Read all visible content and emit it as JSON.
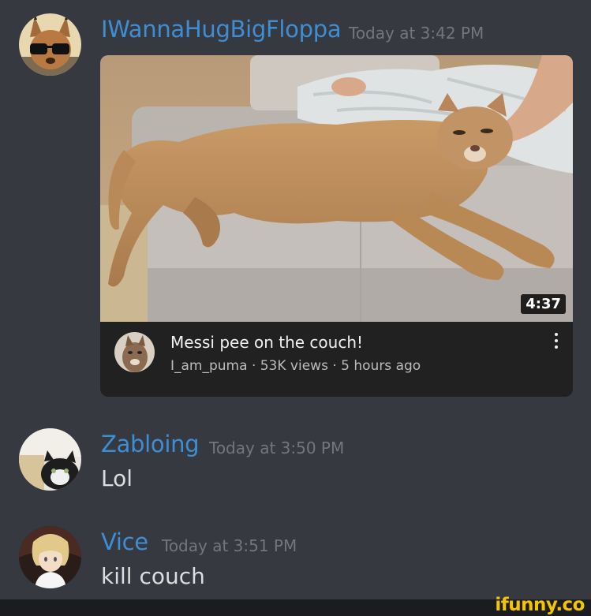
{
  "messages": [
    {
      "author": "IWannaHugBigFloppa",
      "timestamp": "Today at 3:42 PM",
      "author_color": "#3e8ed6"
    },
    {
      "author": "Zabloing",
      "timestamp": "Today at 3:50 PM",
      "text": "Lol",
      "author_color": "#3e8ed6"
    },
    {
      "author": "Vice",
      "timestamp": "Today at 3:51 PM",
      "text": "kill couch",
      "author_color": "#3e8ed6"
    }
  ],
  "embed": {
    "duration": "4:37",
    "title": "Messi pee on the couch!",
    "meta": "I_am_puma · 53K views · 5 hours ago",
    "icon": "more-vertical-icon"
  },
  "watermark": "ifunny.co",
  "colors": {
    "background": "#36393f",
    "text": "#dcddde",
    "timestamp": "#73767d",
    "embed_bg": "#212121",
    "watermark": "#f5c400"
  }
}
